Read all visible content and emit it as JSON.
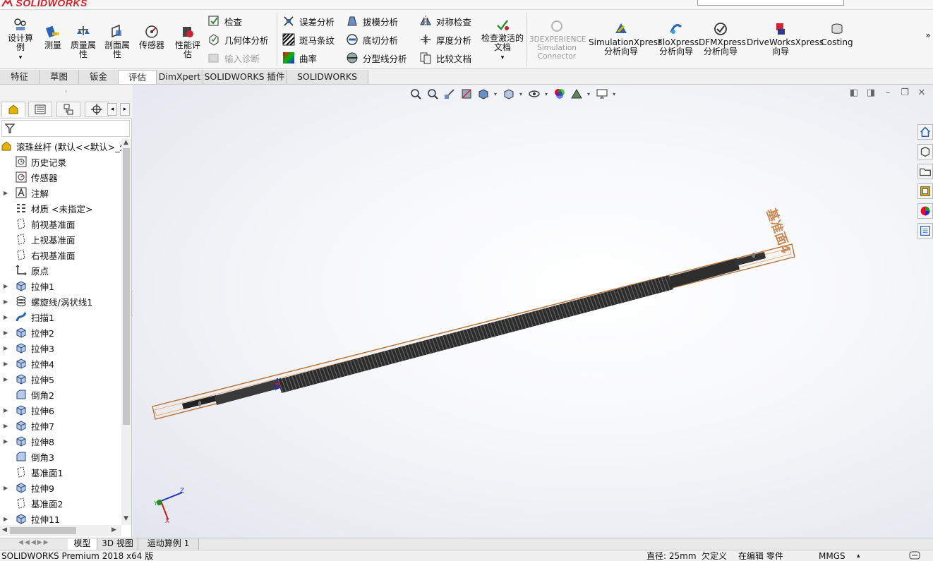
{
  "app": {
    "brand": "SOLIDWORKS"
  },
  "ribbon": {
    "large_buttons": [
      {
        "label": "设计算例",
        "icon": "design-study-icon"
      },
      {
        "label": "测量",
        "icon": "measure-icon"
      },
      {
        "label": "质量属性",
        "icon": "mass-properties-icon"
      },
      {
        "label": "剖面属性",
        "icon": "section-properties-icon"
      },
      {
        "label": "传感器",
        "icon": "sensor-icon"
      },
      {
        "label": "性能评估",
        "icon": "performance-evaluation-icon"
      }
    ],
    "check_group": [
      {
        "label": "检查",
        "icon": "check-icon",
        "enabled": true
      },
      {
        "label": "几何体分析",
        "icon": "geometry-analysis-icon",
        "enabled": true
      },
      {
        "label": "输入诊断",
        "icon": "import-diagnostics-icon",
        "enabled": false
      }
    ],
    "analysis_group1": [
      {
        "label": "误差分析",
        "icon": "deviation-analysis-icon"
      },
      {
        "label": "斑马条纹",
        "icon": "zebra-stripes-icon"
      },
      {
        "label": "曲率",
        "icon": "curvature-icon"
      }
    ],
    "analysis_group2": [
      {
        "label": "拔模分析",
        "icon": "draft-analysis-icon"
      },
      {
        "label": "底切分析",
        "icon": "undercut-analysis-icon"
      },
      {
        "label": "分型线分析",
        "icon": "parting-line-analysis-icon"
      }
    ],
    "analysis_group3": [
      {
        "label": "对称检查",
        "icon": "symmetry-check-icon"
      },
      {
        "label": "厚度分析",
        "icon": "thickness-analysis-icon"
      },
      {
        "label": "比较文档",
        "icon": "compare-documents-icon"
      }
    ],
    "check_active": {
      "label": "检查激活的文档",
      "icon": "check-active-document-icon"
    },
    "right_buttons": [
      {
        "label": "3DEXPERIENCE Simulation Connector",
        "icon": "3dexperience-icon",
        "enabled": false
      },
      {
        "label": "SimulationXpress 分析向导",
        "icon": "simulationxpress-icon",
        "enabled": true
      },
      {
        "label": "FloXpress 分析向导",
        "icon": "floxpress-icon",
        "enabled": true
      },
      {
        "label": "DFMXpress 分析向导",
        "icon": "dfmxpress-icon",
        "enabled": true
      },
      {
        "label": "DriveWorksXpress 向导",
        "icon": "driveworksxpress-icon",
        "enabled": true
      },
      {
        "label": "Costing",
        "icon": "costing-icon",
        "enabled": true
      }
    ],
    "more": "»"
  },
  "tabs": [
    {
      "label": "特征",
      "active": false
    },
    {
      "label": "草图",
      "active": false
    },
    {
      "label": "钣金",
      "active": false
    },
    {
      "label": "评估",
      "active": true
    },
    {
      "label": "DimXpert",
      "active": false
    },
    {
      "label": "SOLIDWORKS 插件",
      "active": false
    },
    {
      "label": "SOLIDWORKS MBD",
      "active": false
    }
  ],
  "tree": {
    "root": "滚珠丝杆 (默认<<默认>_外",
    "items": [
      {
        "label": "历史记录",
        "icon": "history-icon",
        "expandable": false
      },
      {
        "label": "传感器",
        "icon": "sensor-icon",
        "expandable": false
      },
      {
        "label": "注解",
        "icon": "annotations-icon",
        "expandable": true
      },
      {
        "label": "材质 <未指定>",
        "icon": "material-icon",
        "expandable": false
      },
      {
        "label": "前视基准面",
        "icon": "plane-icon",
        "expandable": false
      },
      {
        "label": "上视基准面",
        "icon": "plane-icon",
        "expandable": false
      },
      {
        "label": "右视基准面",
        "icon": "plane-icon",
        "expandable": false
      },
      {
        "label": "原点",
        "icon": "origin-icon",
        "expandable": false
      },
      {
        "label": "拉伸1",
        "icon": "extrude-icon",
        "expandable": true
      },
      {
        "label": "螺旋线/涡状线1",
        "icon": "helix-icon",
        "expandable": true
      },
      {
        "label": "扫描1",
        "icon": "sweep-icon",
        "expandable": true
      },
      {
        "label": "拉伸2",
        "icon": "extrude-icon",
        "expandable": true
      },
      {
        "label": "拉伸3",
        "icon": "extrude-icon",
        "expandable": true
      },
      {
        "label": "拉伸4",
        "icon": "extrude-icon",
        "expandable": true
      },
      {
        "label": "拉伸5",
        "icon": "extrude-icon",
        "expandable": true
      },
      {
        "label": "倒角2",
        "icon": "chamfer-icon",
        "expandable": false
      },
      {
        "label": "拉伸6",
        "icon": "extrude-icon",
        "expandable": true
      },
      {
        "label": "拉伸7",
        "icon": "extrude-icon",
        "expandable": true
      },
      {
        "label": "拉伸8",
        "icon": "extrude-icon",
        "expandable": true
      },
      {
        "label": "倒角3",
        "icon": "chamfer-icon",
        "expandable": false
      },
      {
        "label": "基准面1",
        "icon": "plane-icon",
        "expandable": false
      },
      {
        "label": "拉伸9",
        "icon": "extrude-icon",
        "expandable": true
      },
      {
        "label": "基准面2",
        "icon": "plane-icon",
        "expandable": false
      },
      {
        "label": "拉伸11",
        "icon": "extrude-icon",
        "expandable": true
      }
    ]
  },
  "viewport": {
    "plane_label": "基准面4",
    "triad": {
      "x": "X",
      "y": "Y",
      "z": "Z"
    }
  },
  "bottom_tabs": [
    {
      "label": "模型",
      "active": true
    },
    {
      "label": "3D 视图",
      "active": false
    },
    {
      "label": "运动算例 1",
      "active": false
    }
  ],
  "status": {
    "product": "SOLIDWORKS Premium 2018 x64 版",
    "diameter": "直径: 25mm",
    "constraint": "欠定义",
    "editing": "在编辑 零件",
    "units": "MMGS"
  }
}
